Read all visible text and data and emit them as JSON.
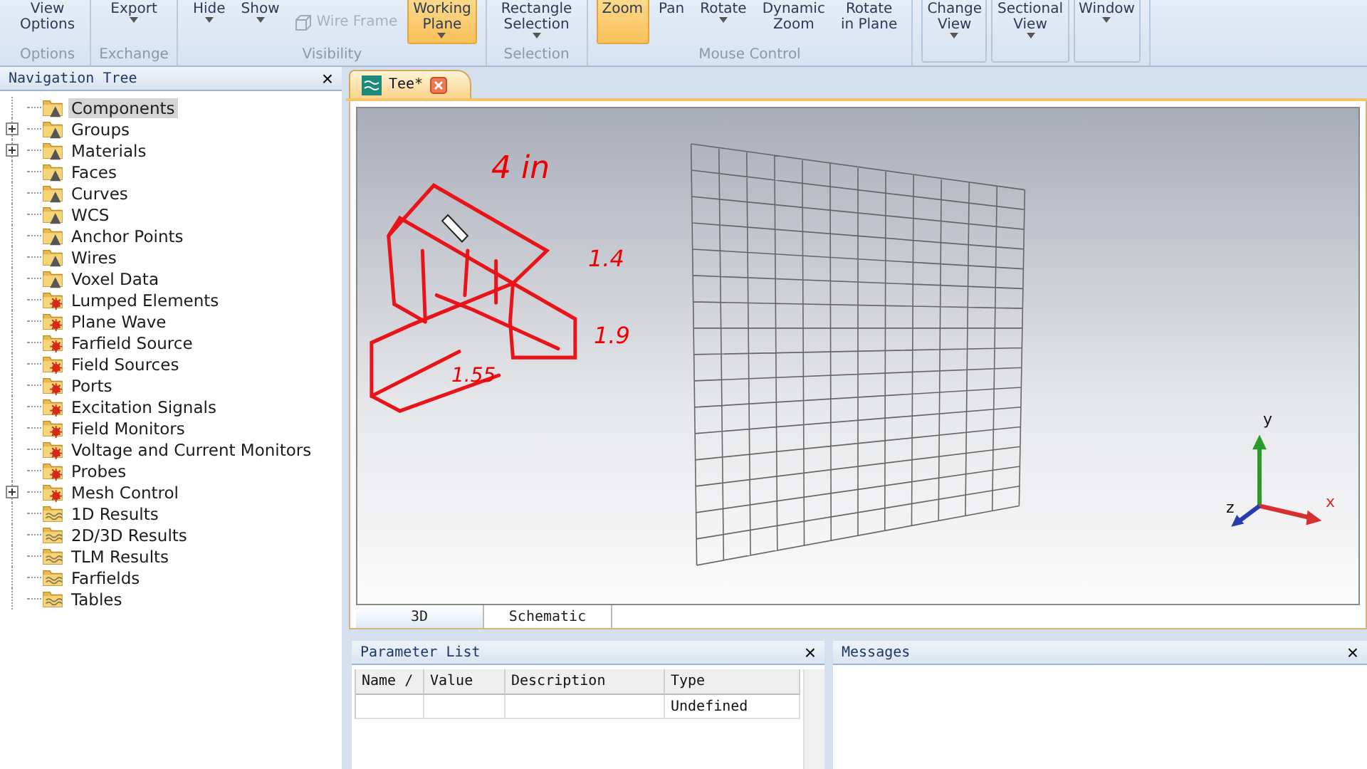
{
  "ribbon": {
    "groups": [
      {
        "label": "Options",
        "buttons": [
          {
            "lines": [
              "View",
              "Options"
            ],
            "kind": "large",
            "caret": false,
            "selected": false,
            "disabled": false
          }
        ]
      },
      {
        "label": "Exchange",
        "buttons": [
          {
            "lines": [
              "Export"
            ],
            "kind": "large",
            "caret": true,
            "selected": false,
            "disabled": false
          }
        ]
      },
      {
        "label": "Visibility",
        "buttons": [
          {
            "lines": [
              "Hide"
            ],
            "kind": "large",
            "caret": true,
            "selected": false,
            "disabled": false
          },
          {
            "lines": [
              "Show"
            ],
            "kind": "large",
            "caret": true,
            "selected": false,
            "disabled": false
          },
          {
            "lines": [
              "Wire Frame"
            ],
            "kind": "small",
            "caret": false,
            "selected": false,
            "disabled": true
          },
          {
            "lines": [
              "Working",
              "Plane"
            ],
            "kind": "large",
            "caret": true,
            "selected": true,
            "disabled": false
          }
        ]
      },
      {
        "label": "Selection",
        "buttons": [
          {
            "lines": [
              "Rectangle",
              "Selection"
            ],
            "kind": "large",
            "caret": true,
            "selected": false,
            "disabled": false
          }
        ]
      },
      {
        "label": "Mouse Control",
        "buttons": [
          {
            "lines": [
              "Zoom"
            ],
            "kind": "large",
            "caret": false,
            "selected": true,
            "disabled": false
          },
          {
            "lines": [
              "Pan"
            ],
            "kind": "large",
            "caret": false,
            "selected": false,
            "disabled": false
          },
          {
            "lines": [
              "Rotate"
            ],
            "kind": "large",
            "caret": true,
            "selected": false,
            "disabled": false
          },
          {
            "lines": [
              "Dynamic",
              "Zoom"
            ],
            "kind": "large",
            "caret": false,
            "selected": false,
            "disabled": false
          },
          {
            "lines": [
              "Rotate",
              "in Plane"
            ],
            "kind": "large",
            "caret": false,
            "selected": false,
            "disabled": false
          }
        ]
      },
      {
        "buttons": [
          {
            "lines": [
              "Change",
              "View"
            ],
            "kind": "boxed",
            "caret": true,
            "selected": false,
            "disabled": false
          },
          {
            "lines": [
              "Sectional",
              "View"
            ],
            "kind": "boxed",
            "caret": true,
            "selected": false,
            "disabled": false
          },
          {
            "lines": [
              "Window"
            ],
            "kind": "boxed",
            "caret": true,
            "selected": false,
            "disabled": false
          }
        ]
      }
    ]
  },
  "navigation_tree": {
    "title": "Navigation Tree",
    "close": "×",
    "items": [
      {
        "label": "Components",
        "kind": "warning",
        "expandable": false,
        "selected": true
      },
      {
        "label": "Groups",
        "kind": "warning",
        "expandable": true,
        "selected": false
      },
      {
        "label": "Materials",
        "kind": "warning",
        "expandable": true,
        "selected": false
      },
      {
        "label": "Faces",
        "kind": "warning",
        "expandable": false,
        "selected": false
      },
      {
        "label": "Curves",
        "kind": "warning",
        "expandable": false,
        "selected": false
      },
      {
        "label": "WCS",
        "kind": "warning",
        "expandable": false,
        "selected": false
      },
      {
        "label": "Anchor Points",
        "kind": "warning",
        "expandable": false,
        "selected": false
      },
      {
        "label": "Wires",
        "kind": "warning",
        "expandable": false,
        "selected": false
      },
      {
        "label": "Voxel Data",
        "kind": "warning",
        "expandable": false,
        "selected": false
      },
      {
        "label": "Lumped Elements",
        "kind": "gear",
        "expandable": false,
        "selected": false
      },
      {
        "label": "Plane Wave",
        "kind": "gear",
        "expandable": false,
        "selected": false
      },
      {
        "label": "Farfield Source",
        "kind": "gear",
        "expandable": false,
        "selected": false
      },
      {
        "label": "Field Sources",
        "kind": "gear",
        "expandable": false,
        "selected": false
      },
      {
        "label": "Ports",
        "kind": "gear",
        "expandable": false,
        "selected": false
      },
      {
        "label": "Excitation Signals",
        "kind": "gear",
        "expandable": false,
        "selected": false
      },
      {
        "label": "Field Monitors",
        "kind": "gear",
        "expandable": false,
        "selected": false
      },
      {
        "label": "Voltage and Current Monitors",
        "kind": "gear",
        "expandable": false,
        "selected": false
      },
      {
        "label": "Probes",
        "kind": "gear",
        "expandable": false,
        "selected": false
      },
      {
        "label": "Mesh Control",
        "kind": "gear",
        "expandable": true,
        "selected": false
      },
      {
        "label": "1D Results",
        "kind": "wave",
        "expandable": false,
        "selected": false
      },
      {
        "label": "2D/3D Results",
        "kind": "wave",
        "expandable": false,
        "selected": false
      },
      {
        "label": "TLM Results",
        "kind": "wave",
        "expandable": false,
        "selected": false
      },
      {
        "label": "Farfields",
        "kind": "wave",
        "expandable": false,
        "selected": false
      },
      {
        "label": "Tables",
        "kind": "wave",
        "expandable": false,
        "selected": false
      }
    ]
  },
  "document_tab": {
    "title": "Tee*"
  },
  "viewport": {
    "annotations": [
      "4 in",
      "1.4",
      "1.9",
      "1.55"
    ],
    "axes": {
      "y": "y",
      "z": "z",
      "x": "x"
    }
  },
  "view_tabs": [
    {
      "label": "3D",
      "selected": true
    },
    {
      "label": "Schematic",
      "selected": false
    }
  ],
  "parameter_list": {
    "title": "Parameter List",
    "close": "×",
    "columns": [
      "Name /",
      "Value",
      "Description",
      "Type"
    ],
    "rows": [
      [
        "",
        "",
        "",
        "Undefined"
      ]
    ]
  },
  "messages": {
    "title": "Messages",
    "close": "×"
  }
}
